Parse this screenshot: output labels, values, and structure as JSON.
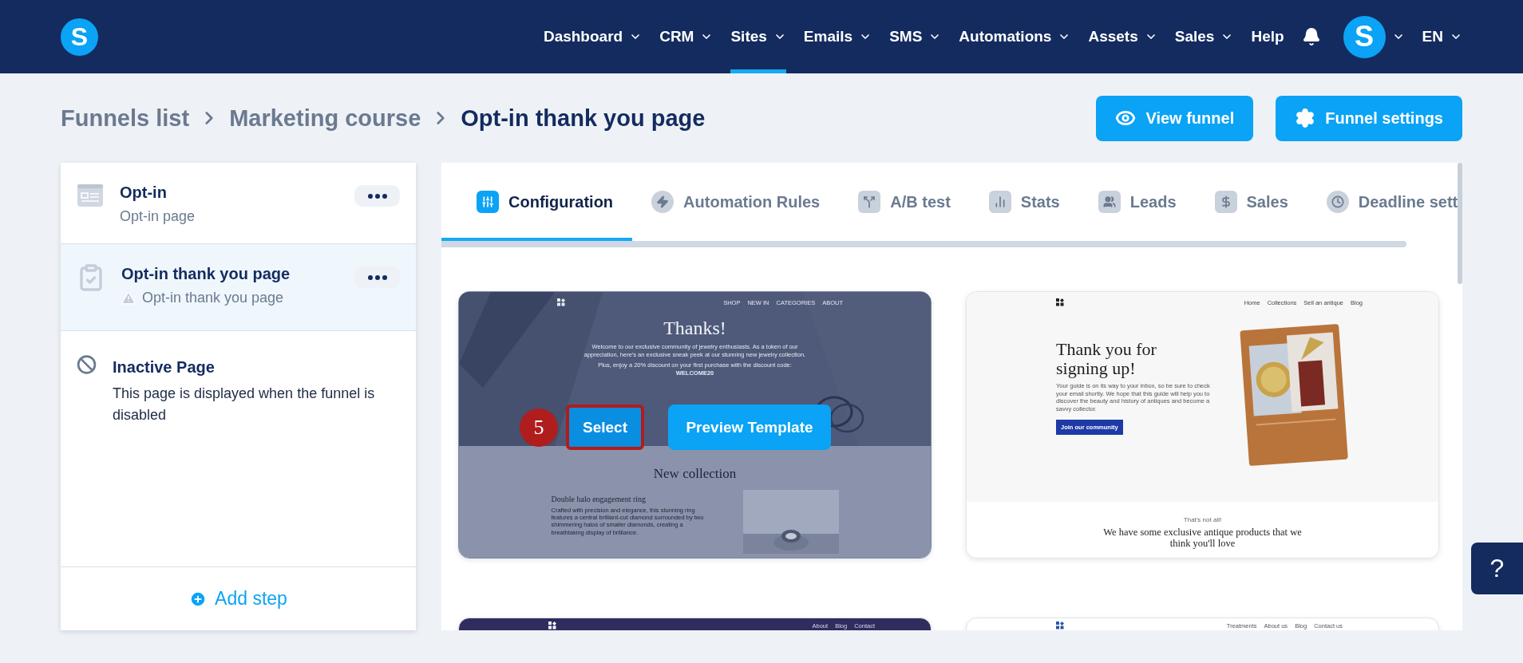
{
  "topbar": {
    "logo": "S",
    "menu": [
      {
        "label": "Dashboard",
        "dropdown": true,
        "selected": false
      },
      {
        "label": "CRM",
        "dropdown": true,
        "selected": false
      },
      {
        "label": "Sites",
        "dropdown": true,
        "selected": true
      },
      {
        "label": "Emails",
        "dropdown": true,
        "selected": false
      },
      {
        "label": "SMS",
        "dropdown": true,
        "selected": false
      },
      {
        "label": "Automations",
        "dropdown": true,
        "selected": false
      },
      {
        "label": "Assets",
        "dropdown": true,
        "selected": false
      },
      {
        "label": "Sales",
        "dropdown": true,
        "selected": false
      },
      {
        "label": "Help",
        "dropdown": false,
        "selected": false
      }
    ],
    "avatar": "S",
    "language": "EN"
  },
  "breadcrumb": [
    {
      "label": "Funnels list",
      "current": false
    },
    {
      "label": "Marketing course",
      "current": false
    },
    {
      "label": "Opt-in thank you page",
      "current": true
    }
  ],
  "actions": [
    {
      "label": "View funnel",
      "kind": "view"
    },
    {
      "label": "Funnel settings",
      "kind": "settings"
    }
  ],
  "steps": [
    {
      "kind": "form",
      "title": "Opt-in",
      "subtitle": "Opt-in page",
      "warning": false,
      "selected": false
    },
    {
      "kind": "thankyou",
      "title": "Opt-in thank you page",
      "subtitle": "Opt-in thank you page",
      "warning": true,
      "selected": true
    }
  ],
  "inactive_page": {
    "title": "Inactive Page",
    "description": "This page is displayed when the funnel is disabled"
  },
  "add_step": "Add step",
  "tabs": [
    {
      "label": "Configuration",
      "kind": "configuration",
      "selected": true
    },
    {
      "label": "Automation Rules",
      "kind": "automation",
      "selected": false
    },
    {
      "label": "A/B test",
      "kind": "abtest",
      "selected": false
    },
    {
      "label": "Stats",
      "kind": "stats",
      "selected": false
    },
    {
      "label": "Leads",
      "kind": "leads",
      "selected": false
    },
    {
      "label": "Sales",
      "kind": "sales",
      "selected": false
    },
    {
      "label": "Deadline sett",
      "kind": "deadline",
      "selected": false
    }
  ],
  "templates": [
    {
      "kind": "jewelry",
      "hovered": true,
      "nav": [
        "SHOP",
        "NEW IN",
        "CATEGORIES",
        "ABOUT"
      ],
      "headline": "Thanks!",
      "paragraphs": [
        "Welcome to our exclusive community of jewelry enthusiasts. As a token of our appreciation, here's an exclusive sneak peek at our stunning new jewelry collection.",
        "Plus, enjoy a 20% discount on your first purchase with the discount code:"
      ],
      "code": "WELCOME20",
      "section_title": "New collection",
      "product_title": "Double halo engagement ring",
      "product_text": "Crafted with precision and elegance, this stunning ring features a central brilliant-cut diamond surrounded by two shimmering halos of smaller diamonds, creating a breathtaking display of brilliance.",
      "overlay": {
        "badge": "5",
        "select": "Select",
        "select_highlighted": true,
        "preview": "Preview Template"
      }
    },
    {
      "kind": "antiques",
      "hovered": false,
      "nav": [
        "Home",
        "Collections",
        "Sell an antique",
        "Blog"
      ],
      "headline": "Thank you for signing up!",
      "text": "Your guide is on its way to your inbox, so be sure to check your email shortly. We hope that this guide will help you to discover the beauty and history of antiques and become a savvy collector.",
      "button": "Join our community",
      "kicker": "That's not all!",
      "section_title": "We have some exclusive antique products that we think you'll love"
    },
    {
      "kind": "dark",
      "hovered": false,
      "nav": [
        "About",
        "Blog",
        "Contact"
      ]
    },
    {
      "kind": "light",
      "hovered": false,
      "nav": [
        "Treatments",
        "About us",
        "Blog",
        "Contact us"
      ]
    }
  ],
  "help": "?"
}
